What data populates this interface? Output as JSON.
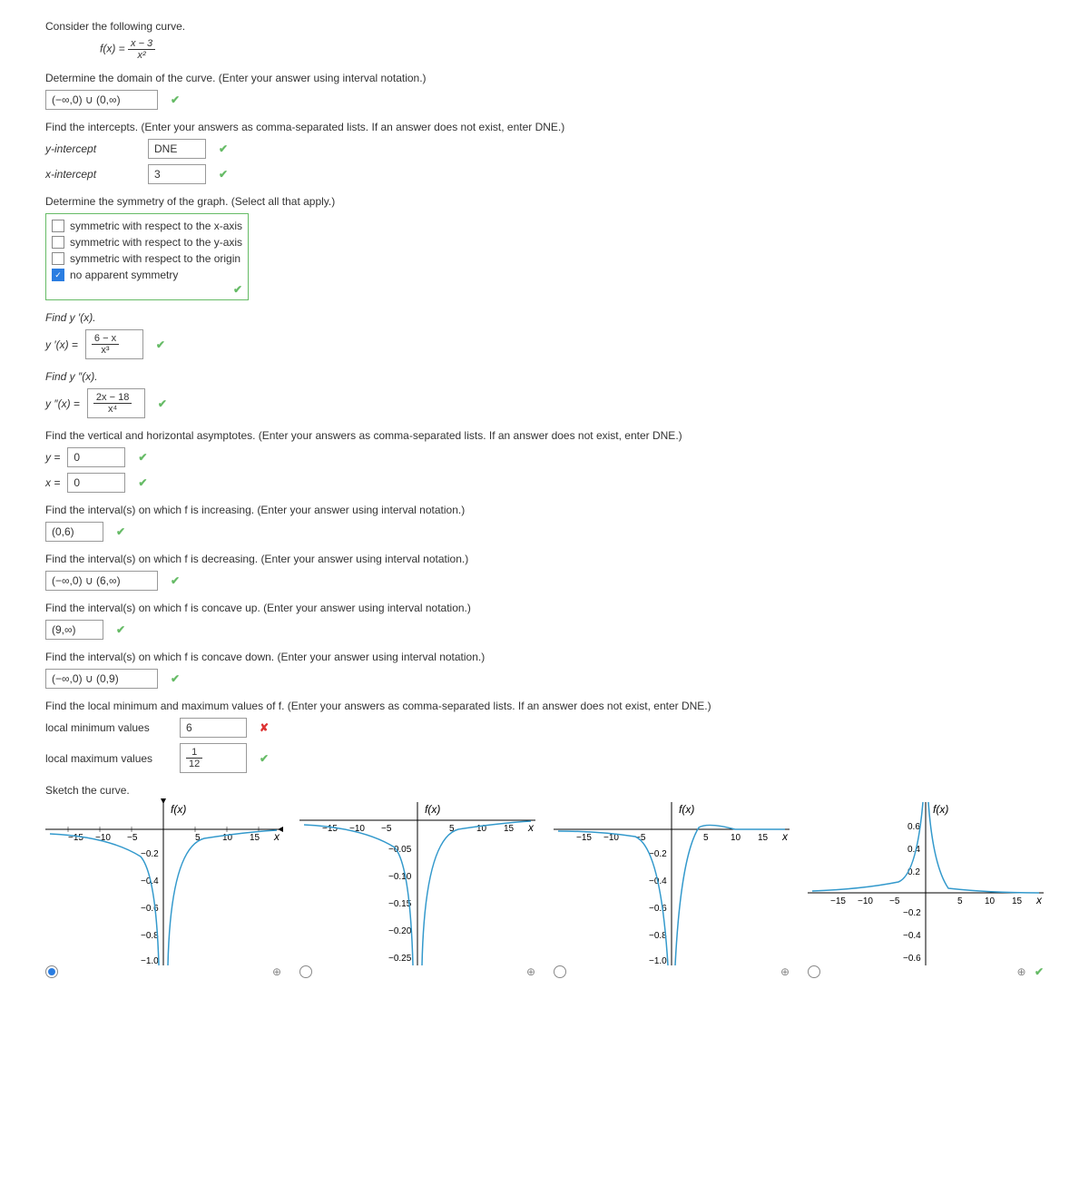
{
  "intro": "Consider the following curve.",
  "fx_label": "f(x) =",
  "fx_num": "x − 3",
  "fx_den": "x²",
  "domain_prompt": "Determine the domain of the curve. (Enter your answer using interval notation.)",
  "domain_val": "(−∞,0) ∪ (0,∞)",
  "intercepts_prompt": "Find the intercepts. (Enter your answers as comma-separated lists. If an answer does not exist, enter DNE.)",
  "yint_label": "y-intercept",
  "yint_val": "DNE",
  "xint_label": "x-intercept",
  "xint_val": "3",
  "sym_prompt": "Determine the symmetry of the graph. (Select all that apply.)",
  "sym1": "symmetric with respect to the x-axis",
  "sym2": "symmetric with respect to the y-axis",
  "sym3": "symmetric with respect to the origin",
  "sym4": "no apparent symmetry",
  "yp_prompt": "Find y ′(x).",
  "yp_label": "y ′(x) =",
  "yp_num": "6 − x",
  "yp_den": "x³",
  "ypp_prompt": "Find y ″(x).",
  "ypp_label": "y ″(x) =",
  "ypp_num": "2x − 18",
  "ypp_den": "x⁴",
  "asym_prompt": "Find the vertical and horizontal asymptotes. (Enter your answers as comma-separated lists. If an answer does not exist, enter DNE.)",
  "ha_label": "y =",
  "ha_val": "0",
  "va_label": "x =",
  "va_val": "0",
  "inc_prompt": "Find the interval(s) on which f is increasing. (Enter your answer using interval notation.)",
  "inc_val": "(0,6)",
  "dec_prompt": "Find the interval(s) on which f is decreasing. (Enter your answer using interval notation.)",
  "dec_val": "(−∞,0) ∪ (6,∞)",
  "cu_prompt": "Find the interval(s) on which f is concave up. (Enter your answer using interval notation.)",
  "cu_val": "(9,∞)",
  "cd_prompt": "Find the interval(s) on which f is concave down. (Enter your answer using interval notation.)",
  "cd_val": "(−∞,0) ∪ (0,9)",
  "ext_prompt": "Find the local minimum and maximum values of f. (Enter your answers as comma-separated lists. If an answer does not exist, enter DNE.)",
  "min_label": "local minimum values",
  "min_val": "6",
  "max_label": "local maximum values",
  "max_num": "1",
  "max_den": "12",
  "sketch": "Sketch the curve.",
  "flabel": "f(x)",
  "xlabel": "x",
  "ticks_x": [
    "−15",
    "−10",
    "−5",
    "5",
    "10",
    "15"
  ],
  "ticksA_y": [
    "−0.2",
    "−0.4",
    "−0.6",
    "−0.8",
    "−1.0"
  ],
  "ticksB_y": [
    "−0.05",
    "−0.10",
    "−0.15",
    "−0.20",
    "−0.25"
  ],
  "ticksD_y": [
    "0.6",
    "0.4",
    "0.2",
    "−0.2",
    "−0.4",
    "−0.6"
  ],
  "mag": "⊕"
}
